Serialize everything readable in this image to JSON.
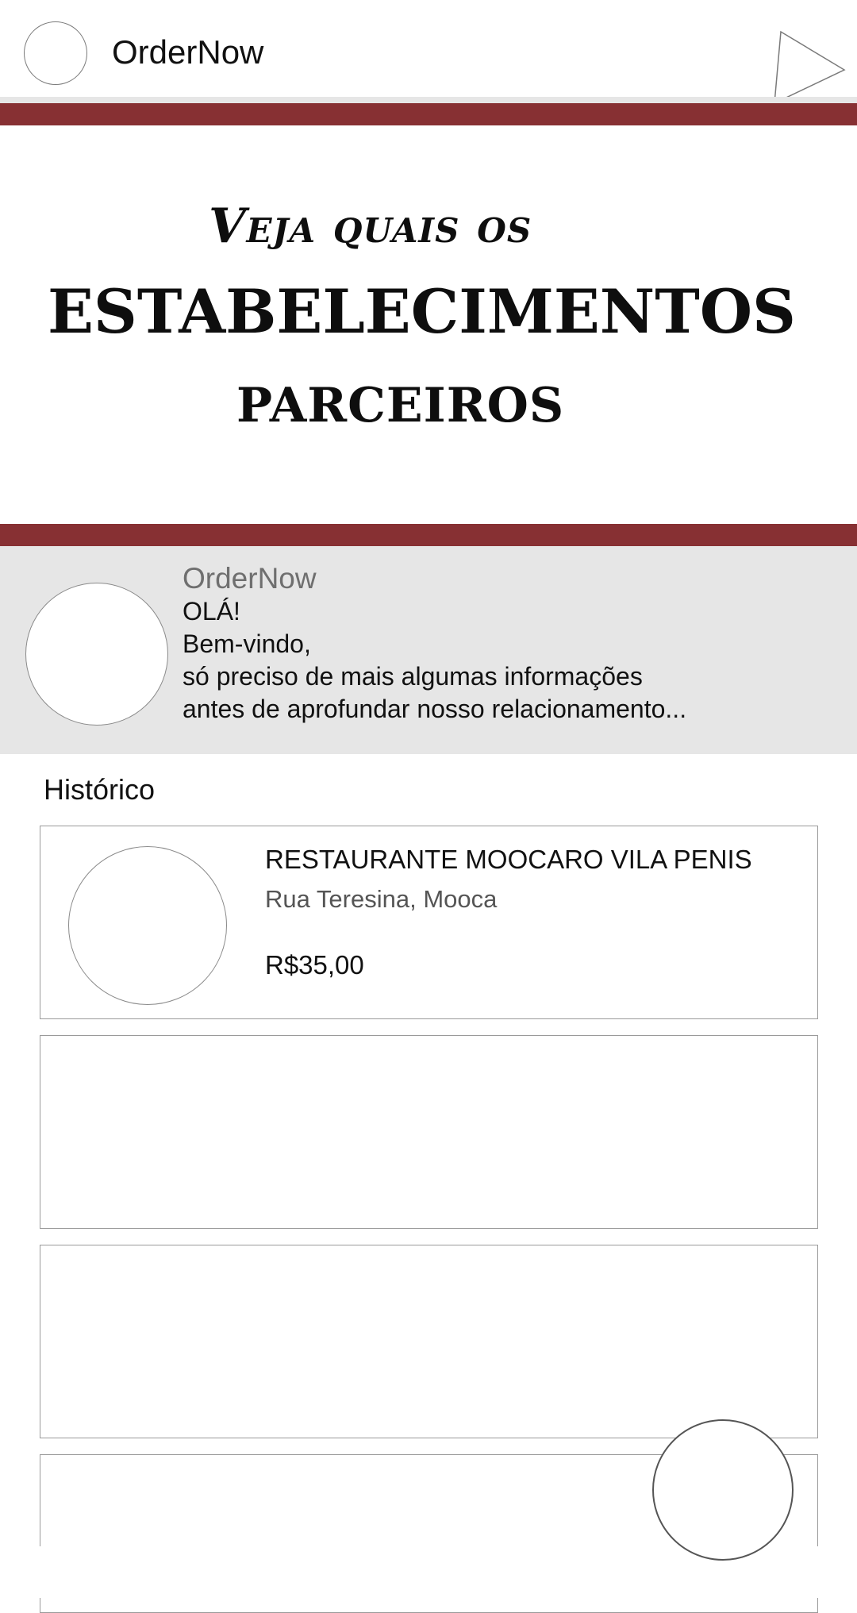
{
  "header": {
    "app_title": "OrderNow"
  },
  "hero": {
    "line1": "Veja quais os",
    "line2": "ESTABELECIMENTOS",
    "line3": "PARCEIROS"
  },
  "welcome": {
    "sender": "OrderNow",
    "lines": [
      "OLÁ!",
      "Bem-vindo,",
      "só preciso de mais algumas informações",
      "antes de aprofundar nosso relacionamento..."
    ]
  },
  "history": {
    "title": "Histórico",
    "items": [
      {
        "name": "RESTAURANTE MOOCARO VILA PENIS",
        "address": "Rua Teresina, Mooca",
        "price": "R$35,00"
      }
    ]
  },
  "colors": {
    "accent_band": "#873033",
    "panel_gray": "#e6e6e6"
  },
  "icons": {
    "header_action": "play-icon",
    "floating_action": "circle-button"
  }
}
